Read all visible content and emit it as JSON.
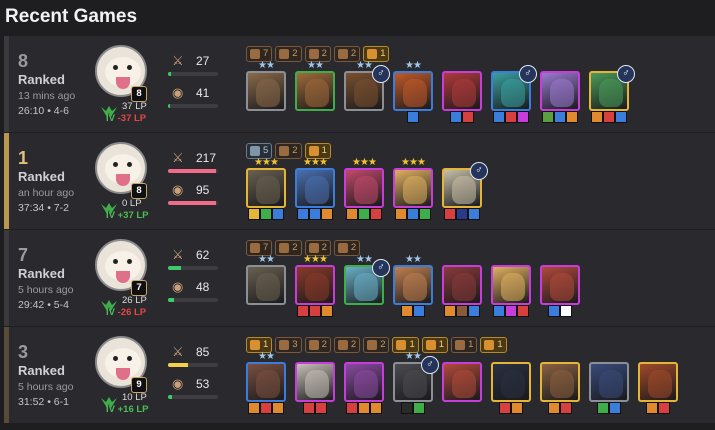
{
  "section_title": "Recent Games",
  "colors": {
    "cost1": "#8b8f96",
    "cost2": "#3fae4a",
    "cost3": "#3a7ddb",
    "cost4": "#c63ddc",
    "cost5": "#e5b53a",
    "star_silver": "#9ec6e8",
    "star_gold": "#f2c230"
  },
  "games": [
    {
      "placement": "8",
      "queue": "Ranked",
      "time_ago": "13 mins ago",
      "duration": "26:10 • 4-6",
      "accent": "#3a3a3e",
      "level": "8",
      "lp": "37 LP",
      "tier": "IV",
      "lp_change": "-37 LP",
      "lp_sign": "neg",
      "damage": "27",
      "damage_fill": 0.05,
      "damage_color": "#3ec96b",
      "gold": "41",
      "gold_fill": 0.03,
      "gold_color": "#3ec96b",
      "traits": [
        {
          "count": "7",
          "style": "bronze",
          "icon": "trait-icon"
        },
        {
          "count": "2",
          "style": "bronze",
          "icon": "trait-icon"
        },
        {
          "count": "2",
          "style": "bronze",
          "icon": "trait-icon"
        },
        {
          "count": "2",
          "style": "bronze",
          "icon": "trait-icon"
        },
        {
          "count": "1",
          "style": "gold",
          "icon": "trait-icon"
        }
      ],
      "units": [
        {
          "cost": 1,
          "stars": 2,
          "items": [],
          "chosen": false,
          "tint": "#8a6a4a"
        },
        {
          "cost": 2,
          "stars": 2,
          "items": [],
          "chosen": false,
          "tint": "#a06a3a"
        },
        {
          "cost": 1,
          "stars": 2,
          "items": [],
          "chosen": true,
          "tint": "#7a5030"
        },
        {
          "cost": 3,
          "stars": 2,
          "items": [
            "#3a7ddb"
          ],
          "chosen": false,
          "tint": "#c05a2a"
        },
        {
          "cost": 4,
          "stars": 0,
          "items": [
            "#3a7ddb",
            "#d84040"
          ],
          "chosen": false,
          "tint": "#b03a3a"
        },
        {
          "cost": 3,
          "stars": 0,
          "items": [
            "#3a7ddb",
            "#d84040",
            "#c63ddc"
          ],
          "chosen": true,
          "tint": "#3aa0a0"
        },
        {
          "cost": 4,
          "stars": 0,
          "items": [
            "#5aa040",
            "#3a7ddb",
            "#e08a30"
          ],
          "chosen": false,
          "tint": "#9a7ad0"
        },
        {
          "cost": 5,
          "stars": 0,
          "items": [
            "#e08a30",
            "#d84040",
            "#3a7ddb"
          ],
          "chosen": true,
          "tint": "#4a9a5a"
        }
      ]
    },
    {
      "placement": "1",
      "queue": "Ranked",
      "time_ago": "an hour ago",
      "duration": "37:34 • 7-2",
      "accent": "#b9974e",
      "level": "8",
      "lp": "0 LP",
      "tier": "IV",
      "lp_change": "+37 LP",
      "lp_sign": "pos",
      "damage": "217",
      "damage_fill": 0.95,
      "damage_color": "#f06a8a",
      "gold": "95",
      "gold_fill": 0.95,
      "gold_color": "#f06a8a",
      "traits": [
        {
          "count": "5",
          "style": "silver",
          "icon": "trait-icon"
        },
        {
          "count": "2",
          "style": "bronze",
          "icon": "trait-icon"
        },
        {
          "count": "1",
          "style": "gold",
          "icon": "trait-icon"
        }
      ],
      "units": [
        {
          "cost": 5,
          "stars": 3,
          "items": [
            "#e5b53a",
            "#3fae4a",
            "#3a7ddb"
          ],
          "chosen": false,
          "tint": "#6a6050"
        },
        {
          "cost": 3,
          "stars": 3,
          "items": [
            "#3a7ddb",
            "#3a7ddb",
            "#e08a30"
          ],
          "chosen": false,
          "tint": "#4a70b0"
        },
        {
          "cost": 4,
          "stars": 3,
          "items": [
            "#e08a30",
            "#3fae4a",
            "#d84040"
          ],
          "chosen": false,
          "tint": "#c04a6a"
        },
        {
          "cost": 4,
          "stars": 3,
          "items": [
            "#e08a30",
            "#3a7ddb",
            "#3fae4a"
          ],
          "chosen": false,
          "tint": "#e0b060"
        },
        {
          "cost": 5,
          "stars": 0,
          "items": [
            "#d84040",
            "#2a3a8a",
            "#3a7ddb"
          ],
          "chosen": true,
          "tint": "#c8c0a8"
        }
      ]
    },
    {
      "placement": "7",
      "queue": "Ranked",
      "time_ago": "5 hours ago",
      "duration": "29:42 • 5-4",
      "accent": "#3a3a3e",
      "level": "7",
      "lp": "26 LP",
      "tier": "IV",
      "lp_change": "-26 LP",
      "lp_sign": "neg",
      "damage": "62",
      "damage_fill": 0.25,
      "damage_color": "#3ec96b",
      "gold": "48",
      "gold_fill": 0.12,
      "gold_color": "#3ec96b",
      "traits": [
        {
          "count": "7",
          "style": "bronze",
          "icon": "trait-icon"
        },
        {
          "count": "2",
          "style": "bronze",
          "icon": "trait-icon"
        },
        {
          "count": "2",
          "style": "bronze",
          "icon": "trait-icon"
        },
        {
          "count": "2",
          "style": "bronze",
          "icon": "trait-icon"
        }
      ],
      "units": [
        {
          "cost": 1,
          "stars": 2,
          "items": [],
          "chosen": false,
          "tint": "#6a6050"
        },
        {
          "cost": 4,
          "stars": 3,
          "items": [
            "#d84040",
            "#d84040",
            "#e08a30"
          ],
          "chosen": false,
          "tint": "#8a3a2a"
        },
        {
          "cost": 2,
          "stars": 2,
          "items": [],
          "chosen": true,
          "tint": "#6ab0c8"
        },
        {
          "cost": 3,
          "stars": 2,
          "items": [
            "#e08a30",
            "#3a7ddb"
          ],
          "chosen": false,
          "tint": "#c08050"
        },
        {
          "cost": 4,
          "stars": 0,
          "items": [
            "#e08a30",
            "#8a5a3a",
            "#3a7ddb"
          ],
          "chosen": false,
          "tint": "#8a3a3a"
        },
        {
          "cost": 4,
          "stars": 0,
          "items": [
            "#3a7ddb",
            "#c63ddc",
            "#d84040"
          ],
          "chosen": false,
          "tint": "#e0b060"
        },
        {
          "cost": 4,
          "stars": 0,
          "items": [
            "#3a7ddb",
            "#ffffff"
          ],
          "chosen": false,
          "tint": "#b04a3a"
        }
      ]
    },
    {
      "placement": "3",
      "queue": "Ranked",
      "time_ago": "5 hours ago",
      "duration": "31:52 • 6-1",
      "accent": "#5a4a38",
      "level": "9",
      "lp": "10 LP",
      "tier": "IV",
      "lp_change": "+16 LP",
      "lp_sign": "pos",
      "damage": "85",
      "damage_fill": 0.4,
      "damage_color": "#f2d24a",
      "gold": "53",
      "gold_fill": 0.08,
      "gold_color": "#3ec96b",
      "traits": [
        {
          "count": "1",
          "style": "gold",
          "icon": "trait-icon"
        },
        {
          "count": "3",
          "style": "bronze",
          "icon": "trait-icon"
        },
        {
          "count": "2",
          "style": "bronze",
          "icon": "trait-icon"
        },
        {
          "count": "2",
          "style": "bronze",
          "icon": "trait-icon"
        },
        {
          "count": "2",
          "style": "bronze",
          "icon": "trait-icon"
        },
        {
          "count": "1",
          "style": "gold",
          "icon": "trait-icon"
        },
        {
          "count": "1",
          "style": "gold",
          "icon": "trait-icon"
        },
        {
          "count": "1",
          "style": "bronze",
          "icon": "trait-icon"
        },
        {
          "count": "1",
          "style": "gold",
          "icon": "trait-icon"
        }
      ],
      "units": [
        {
          "cost": 3,
          "stars": 2,
          "items": [
            "#e08a30",
            "#d84040",
            "#e08a30"
          ],
          "chosen": false,
          "tint": "#7a5040"
        },
        {
          "cost": 4,
          "stars": 0,
          "items": [
            "#d84040",
            "#d84040"
          ],
          "chosen": false,
          "tint": "#c8c0b8"
        },
        {
          "cost": 4,
          "stars": 0,
          "items": [
            "#d84040",
            "#e08a30",
            "#e08a30"
          ],
          "chosen": false,
          "tint": "#8a4aa0"
        },
        {
          "cost": 1,
          "stars": 2,
          "items": [
            "#2a2a2a",
            "#3fae4a"
          ],
          "chosen": true,
          "tint": "#4a4a50"
        },
        {
          "cost": 4,
          "stars": 0,
          "items": [],
          "chosen": false,
          "tint": "#b04a3a"
        },
        {
          "cost": 5,
          "stars": 0,
          "items": [
            "#d84040",
            "#e08a30"
          ],
          "chosen": false,
          "tint": "#2a3040"
        },
        {
          "cost": 5,
          "stars": 0,
          "items": [
            "#e08a30",
            "#d84040"
          ],
          "chosen": false,
          "tint": "#8a6040"
        },
        {
          "cost": 1,
          "stars": 0,
          "items": [
            "#3fae4a",
            "#3a7ddb"
          ],
          "chosen": false,
          "tint": "#3a4a7a"
        },
        {
          "cost": 5,
          "stars": 0,
          "items": [
            "#e08a30",
            "#d84040"
          ],
          "chosen": false,
          "tint": "#a04a2a"
        }
      ]
    }
  ]
}
